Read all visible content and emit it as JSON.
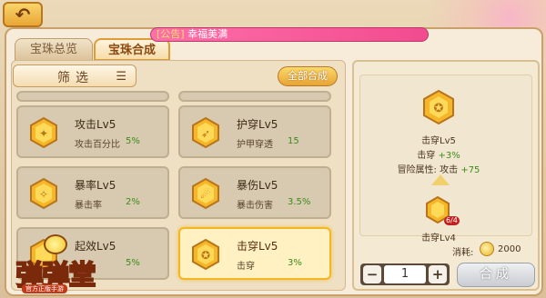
{
  "announcement": {
    "tag": "[公告]",
    "text": "幸福美满"
  },
  "tabs": [
    {
      "label": "宝珠总览",
      "active": false
    },
    {
      "label": "宝珠合成",
      "active": true
    }
  ],
  "filter": {
    "label": "筛选"
  },
  "merge_all_label": "全部合成",
  "gems": [
    {
      "name": "攻击Lv5",
      "attr": "攻击百分比",
      "value": "5%",
      "icon": "sword-gem-icon"
    },
    {
      "name": "护穿Lv5",
      "attr": "护甲穿透",
      "value": "15",
      "icon": "pierce-gem-icon"
    },
    {
      "name": "暴率Lv5",
      "attr": "暴击率",
      "value": "2%",
      "icon": "crit-gem-icon"
    },
    {
      "name": "暴伤Lv5",
      "attr": "暴击伤害",
      "value": "3.5%",
      "icon": "critdmg-gem-icon"
    },
    {
      "name": "起效Lv5",
      "attr": "",
      "value": "5%",
      "icon": "effect-gem-icon"
    },
    {
      "name": "击穿Lv5",
      "attr": "击穿",
      "value": "3%",
      "icon": "breach-gem-icon",
      "selected": true
    }
  ],
  "detail": {
    "target_name": "击穿Lv5",
    "target_stat_label": "击穿",
    "target_stat_value": "+3%",
    "adventure_label": "冒险属性: 攻击",
    "adventure_value": "+75",
    "source_name": "击穿Lv4",
    "source_badge": "6/4",
    "cost_label": "消耗:",
    "cost_value": "2000",
    "quantity": "1",
    "merge_label": "合成"
  },
  "logo": {
    "title": "弹弹堂",
    "subtitle": "官方正版手游"
  },
  "colors": {
    "accent": "#f4b624",
    "announce": "#f24b8f",
    "green": "#3e8a1e"
  }
}
